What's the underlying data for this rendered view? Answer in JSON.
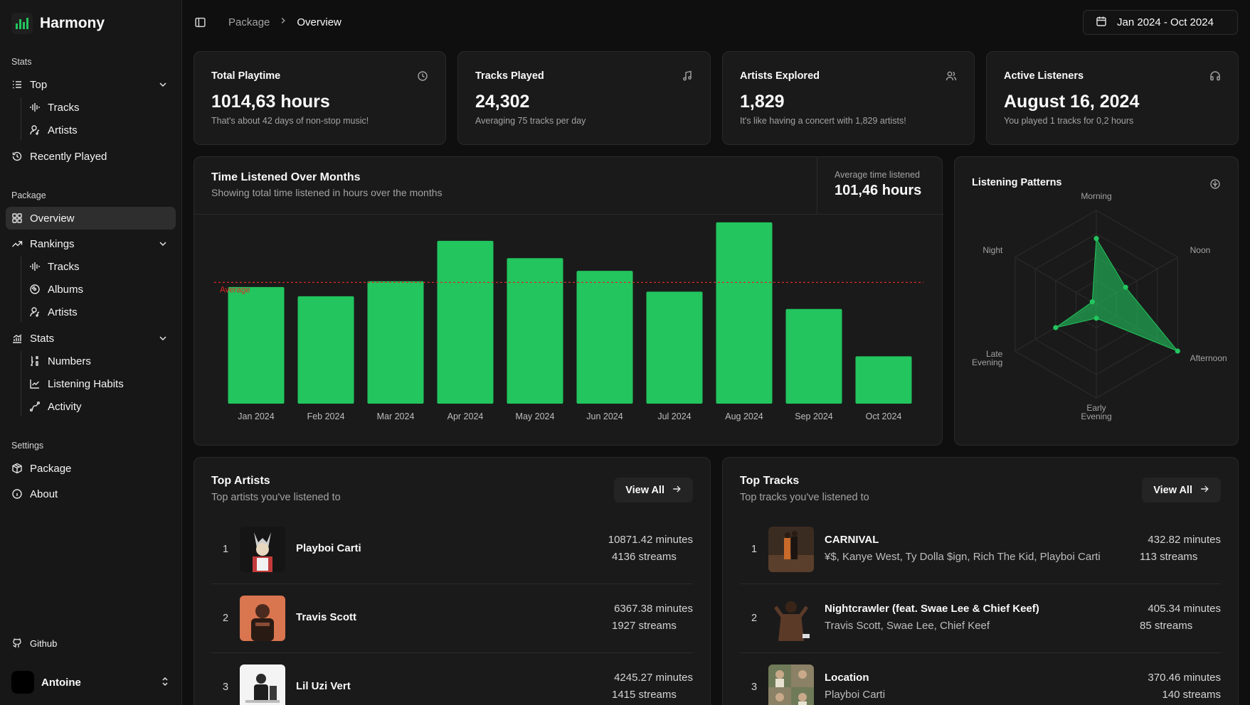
{
  "app": {
    "name": "Harmony"
  },
  "sidebar": {
    "groups": {
      "stats": "Stats",
      "package": "Package",
      "settings": "Settings"
    },
    "top": {
      "label": "Top",
      "items": [
        "Tracks",
        "Artists"
      ]
    },
    "recently_played": "Recently Played",
    "overview": "Overview",
    "rankings": {
      "label": "Rankings",
      "items": [
        "Tracks",
        "Albums",
        "Artists"
      ]
    },
    "stats": {
      "label": "Stats",
      "items": [
        "Numbers",
        "Listening Habits",
        "Activity"
      ]
    },
    "package": "Package",
    "about": "About",
    "github": "Github",
    "user": "Antoine"
  },
  "header": {
    "breadcrumb": [
      "Package",
      "Overview"
    ],
    "date_range": "Jan 2024 - Oct 2024"
  },
  "stats": [
    {
      "title": "Total Playtime",
      "value": "1014,63 hours",
      "sub": "That's about 42 days of non-stop music!",
      "icon": "clock-icon"
    },
    {
      "title": "Tracks Played",
      "value": "24,302",
      "sub": "Averaging 75 tracks per day",
      "icon": "music-note-icon"
    },
    {
      "title": "Artists Explored",
      "value": "1,829",
      "sub": "It's like having a concert with 1,829 artists!",
      "icon": "users-icon"
    },
    {
      "title": "Active Listeners",
      "value": "August 16, 2024",
      "sub": "You played 1 tracks for 0,2 hours",
      "icon": "headphones-icon"
    }
  ],
  "time_chart": {
    "title": "Time Listened Over Months",
    "subtitle": "Showing total time listened in hours over the months",
    "avg_label": "Average time listened",
    "avg_value": "101,46 hours"
  },
  "patterns": {
    "title": "Listening Patterns",
    "labels": [
      "Morning",
      "Noon",
      "Afternoon",
      "Early Evening",
      "Late Evening",
      "Night"
    ]
  },
  "top_artists": {
    "title": "Top Artists",
    "subtitle": "Top artists you've listened to",
    "view_all": "View All",
    "items": [
      {
        "rank": "1",
        "name": "Playboi Carti",
        "minutes": "10871.42 minutes",
        "streams": "4136 streams"
      },
      {
        "rank": "2",
        "name": "Travis Scott",
        "minutes": "6367.38 minutes",
        "streams": "1927 streams"
      },
      {
        "rank": "3",
        "name": "Lil Uzi Vert",
        "minutes": "4245.27 minutes",
        "streams": "1415 streams"
      }
    ]
  },
  "top_tracks": {
    "title": "Top Tracks",
    "subtitle": "Top tracks you've listened to",
    "view_all": "View All",
    "items": [
      {
        "rank": "1",
        "name": "CARNIVAL",
        "artists": "¥$, Kanye West, Ty Dolla $ign, Rich The Kid, Playboi Carti",
        "minutes": "432.82 minutes",
        "streams": "113 streams"
      },
      {
        "rank": "2",
        "name": "Nightcrawler (feat. Swae Lee & Chief Keef)",
        "artists": "Travis Scott, Swae Lee, Chief Keef",
        "minutes": "405.34 minutes",
        "streams": "85 streams"
      },
      {
        "rank": "3",
        "name": "Location",
        "artists": "Playboi Carti",
        "minutes": "370.46 minutes",
        "streams": "140 streams"
      }
    ]
  },
  "chart_data": [
    {
      "type": "bar",
      "categories": [
        "Jan 2024",
        "Feb 2024",
        "Mar 2024",
        "Apr 2024",
        "May 2024",
        "Jun 2024",
        "Jul 2024",
        "Aug 2024",
        "Sep 2024",
        "Oct 2024"
      ],
      "values": [
        101,
        93,
        106,
        141,
        126,
        115,
        97,
        157,
        82,
        41
      ],
      "reference_line": {
        "label": "Average",
        "value": 105
      },
      "ylim": [
        0,
        160
      ],
      "colors": {
        "bar": "#22c55e",
        "reference": "#dc2626"
      }
    },
    {
      "type": "radar",
      "categories": [
        "Morning",
        "Noon",
        "Afternoon",
        "Early Evening",
        "Late Evening",
        "Night"
      ],
      "values": [
        0.7,
        0.36,
        1.0,
        0.15,
        0.5,
        0.05
      ],
      "range": [
        0,
        1
      ],
      "colors": {
        "fill": "#22c55e"
      }
    }
  ]
}
